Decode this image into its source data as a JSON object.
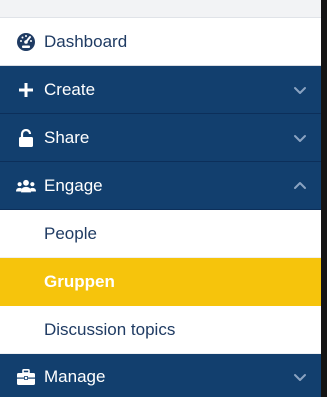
{
  "menu": {
    "dashboard": {
      "label": "Dashboard",
      "icon": "speedometer-icon"
    },
    "create": {
      "label": "Create",
      "icon": "plus-icon",
      "expanded": false
    },
    "share": {
      "label": "Share",
      "icon": "unlock-icon",
      "expanded": false
    },
    "engage": {
      "label": "Engage",
      "icon": "users-icon",
      "expanded": true,
      "children": [
        {
          "label": "People",
          "active": false
        },
        {
          "label": "Gruppen",
          "active": true
        },
        {
          "label": "Discussion topics",
          "active": false
        }
      ]
    },
    "manage": {
      "label": "Manage",
      "icon": "briefcase-icon",
      "expanded": false
    }
  },
  "colors": {
    "dark_row": "#123f6e",
    "active_row": "#f6c40c",
    "light_text": "#1f3b63"
  }
}
